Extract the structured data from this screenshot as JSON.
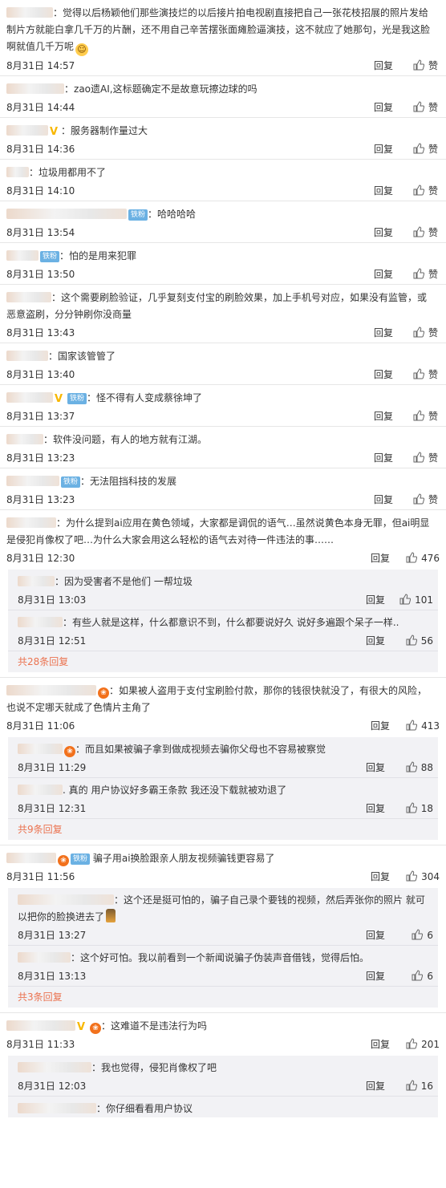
{
  "ui": {
    "reply": "回复",
    "like": "赞"
  },
  "comments": [
    {
      "user": "",
      "text": "觉得以后杨颖他们那些演技烂的以后接片拍电视剧直接把自己一张花枝招展的照片发给制片方就能白拿几千万的片酬，还不用自己辛苦摆张面瘫脸逼演技，这不就应了她那句，光是我这脸啊就值几千万呢",
      "time": "8月31日 14:57",
      "likes": "赞"
    },
    {
      "user": "",
      "text": "zao遗AI,这标题确定不是故意玩擦边球的吗",
      "time": "8月31日 14:44",
      "likes": "赞"
    },
    {
      "user": "",
      "text": "服务器制作量过大",
      "time": "8月31日 14:36",
      "likes": "赞"
    },
    {
      "user": "",
      "text": "垃圾用都用不了",
      "time": "8月31日 14:10",
      "likes": "赞"
    },
    {
      "user": "",
      "text": "哈哈哈哈",
      "time": "8月31日 13:54",
      "likes": "赞",
      "fan": "铁粉"
    },
    {
      "user": "",
      "text": "怕的是用来犯罪",
      "time": "8月31日 13:50",
      "likes": "赞",
      "fan": "铁粉"
    },
    {
      "user": "",
      "text": "这个需要刷脸验证，几乎复刻支付宝的刷脸效果，加上手机号对应，如果没有监管，或恶意盗刷，分分钟刷你没商量",
      "time": "8月31日 13:43",
      "likes": "赞"
    },
    {
      "user": "",
      "text": "国家该管管了",
      "time": "8月31日 13:40",
      "likes": "赞"
    },
    {
      "user": "",
      "text": "怪不得有人变成蔡徐坤了",
      "time": "8月31日 13:37",
      "likes": "赞",
      "fan": "铁粉"
    },
    {
      "user": "",
      "text": "软件没问题，有人的地方就有江湖。",
      "time": "8月31日 13:23",
      "likes": "赞"
    },
    {
      "user": "",
      "text": "无法阻挡科技的发展",
      "time": "8月31日 13:23",
      "likes": "赞",
      "fan": "铁粉"
    },
    {
      "user": "",
      "text": "为什么提到ai应用在黄色领域，大家都是调侃的语气…虽然说黄色本身无罪，但ai明显是侵犯肖像权了吧…为什么大家会用这么轻松的语气去对待一件违法的事……",
      "time": "8月31日 12:30",
      "likes": "476",
      "replies": [
        {
          "text": "因为受害者不是他们  一帮垃圾",
          "time": "8月31日 13:03",
          "likes": "101"
        },
        {
          "text": "有些人就是这样，什么都意识不到，什么都要说好久 说好多遍跟个呆子一样..",
          "time": "8月31日 12:51",
          "likes": "56"
        }
      ],
      "more": "共28条回复"
    },
    {
      "user": "",
      "text": "如果被人盗用于支付宝刷脸付款，那你的钱很快就没了，有很大的风险，也说不定哪天就成了色情片主角了",
      "time": "8月31日 11:06",
      "likes": "413",
      "replies": [
        {
          "text": "而且如果被骗子拿到做成视频去骗你父母也不容易被察觉",
          "time": "8月31日 11:29",
          "likes": "88"
        },
        {
          "text": "真的 用户协议好多霸王条款 我还没下载就被劝退了",
          "time": "8月31日 12:31",
          "likes": "18"
        }
      ],
      "more": "共9条回复"
    },
    {
      "user": "",
      "text": "骗子用ai换脸跟亲人朋友视频骗钱更容易了",
      "time": "8月31日 11:56",
      "likes": "304",
      "fan": "铁粉",
      "replies": [
        {
          "text": "这个还是挺可怕的，骗子自己录个要钱的视频，然后弄张你的照片 就可以把你的脸换进去了",
          "time": "8月31日 13:27",
          "likes": "6"
        },
        {
          "text": "这个好可怕。我以前看到一个新闻说骗子伪装声音借钱，觉得后怕。",
          "time": "8月31日 13:13",
          "likes": "6"
        }
      ],
      "more": "共3条回复"
    },
    {
      "user": "",
      "text": "这难道不是违法行为吗",
      "time": "8月31日 11:33",
      "likes": "201",
      "replies": [
        {
          "text": "我也觉得，侵犯肖像权了吧",
          "time": "8月31日 12:03",
          "likes": "16"
        },
        {
          "text": "你仔细看看用户协议",
          "time": "",
          "likes": ""
        }
      ]
    }
  ]
}
